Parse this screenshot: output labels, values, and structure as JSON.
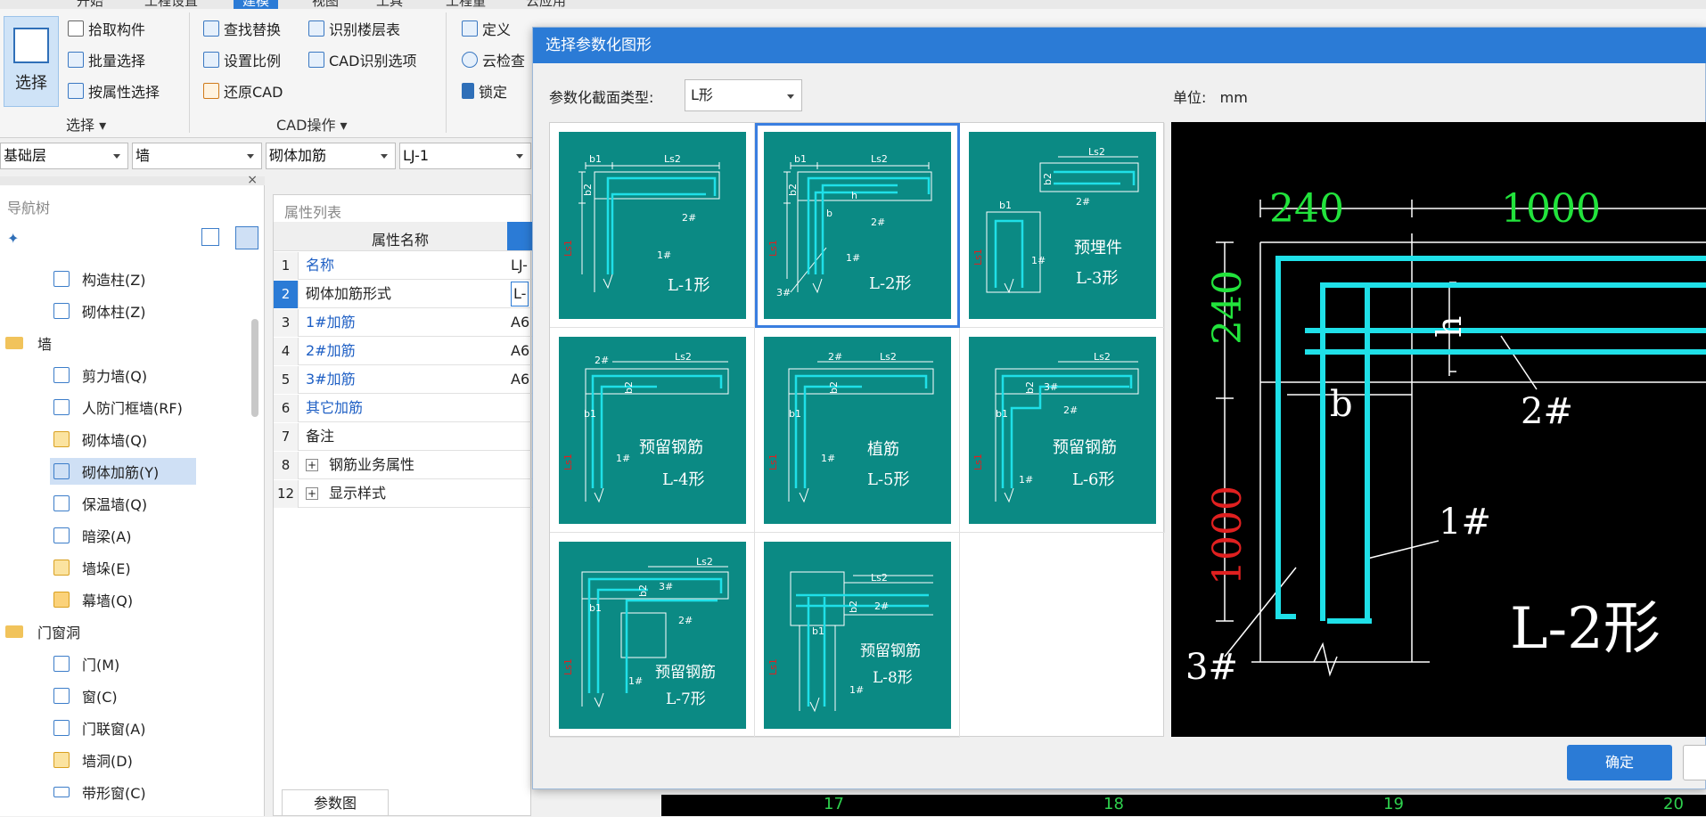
{
  "ribbon": {
    "tabs": [
      "开始",
      "工程设置",
      "建模",
      "视图",
      "工具",
      "工程量",
      "云应用"
    ],
    "active_tab": "建模",
    "select_big": "选择",
    "group_select": {
      "items": [
        "拾取构件",
        "批量选择",
        "按属性选择"
      ],
      "title": "选择"
    },
    "group_cad": {
      "col1": [
        "查找替换",
        "设置比例",
        "还原CAD"
      ],
      "col2": [
        "识别楼层表",
        "CAD识别选项"
      ],
      "title": "CAD操作"
    },
    "group_misc": [
      "定义",
      "云检查",
      "锁定"
    ]
  },
  "toolbar": {
    "floor": "基础层",
    "category": "墙",
    "type": "砌体加筋",
    "instance": "LJ-1"
  },
  "nav": {
    "title": "导航树",
    "items": [
      {
        "label": "构造柱(Z)"
      },
      {
        "label": "砌体柱(Z)"
      },
      {
        "label": "墙",
        "group": true
      },
      {
        "label": "剪力墙(Q)"
      },
      {
        "label": "人防门框墙(RF)"
      },
      {
        "label": "砌体墙(Q)"
      },
      {
        "label": "砌体加筋(Y)",
        "selected": true
      },
      {
        "label": "保温墙(Q)"
      },
      {
        "label": "暗梁(A)"
      },
      {
        "label": "墙垛(E)"
      },
      {
        "label": "幕墙(Q)"
      },
      {
        "label": "门窗洞",
        "group": true
      },
      {
        "label": "门(M)"
      },
      {
        "label": "窗(C)"
      },
      {
        "label": "门联窗(A)"
      },
      {
        "label": "墙洞(D)"
      },
      {
        "label": "带形窗(C)"
      }
    ]
  },
  "props": {
    "title": "属性列表",
    "header": "属性名称",
    "rows": [
      {
        "n": "1",
        "k": "名称",
        "v": "LJ-",
        "blue": true
      },
      {
        "n": "2",
        "k": "砌体加筋形式",
        "v": "L-",
        "blue": false
      },
      {
        "n": "3",
        "k": "1#加筋",
        "v": "A6",
        "blue": true
      },
      {
        "n": "4",
        "k": "2#加筋",
        "v": "A6",
        "blue": true
      },
      {
        "n": "5",
        "k": "3#加筋",
        "v": "A6",
        "blue": true
      },
      {
        "n": "6",
        "k": "其它加筋",
        "v": "",
        "blue": true
      },
      {
        "n": "7",
        "k": "备注",
        "v": "",
        "blue": false
      },
      {
        "n": "8",
        "k": "钢筋业务属性",
        "v": "",
        "blue": false,
        "expand": true
      },
      {
        "n": "12",
        "k": "显示样式",
        "v": "",
        "blue": false,
        "expand": true
      }
    ],
    "bottom_tab": "参数图"
  },
  "cad_bottom": {
    "axes": [
      "17",
      "18",
      "19",
      "20"
    ]
  },
  "dialog": {
    "title": "选择参数化图形",
    "type_label": "参数化截面类型:",
    "type_value": "L形",
    "unit_label": "单位:",
    "unit_value": "mm",
    "ok": "确定",
    "shapes": [
      {
        "name": "L-1形",
        "extra": ""
      },
      {
        "name": "L-2形",
        "extra": "",
        "selected": true
      },
      {
        "name": "L-3形",
        "extra": "预埋件"
      },
      {
        "name": "L-4形",
        "extra": "预留钢筋"
      },
      {
        "name": "L-5形",
        "extra": "植筋"
      },
      {
        "name": "L-6形",
        "extra": "预留钢筋"
      },
      {
        "name": "L-7形",
        "extra": "预留钢筋"
      },
      {
        "name": "L-8形",
        "extra": "预留钢筋"
      }
    ],
    "dim_labels": {
      "b1": "b1",
      "b2": "b2",
      "ls2": "Ls2",
      "ls1": "Ls1",
      "r1": "1#",
      "r2": "2#",
      "r3": "3#",
      "b": "b",
      "h": "h"
    },
    "preview": {
      "dim_b1": "240",
      "dim_ls2": "1000",
      "dim_b2": "240",
      "dim_ls1": "1000",
      "label_h": "h",
      "label_b": "b",
      "label_2": "2#",
      "label_1": "1#",
      "label_3": "3#",
      "shape_name": "L-2形"
    }
  },
  "colors": {
    "accent": "#2b7bd6",
    "thumb_bg": "#0b8a84",
    "rebar": "#1fe0e8",
    "dim_green": "#22e33c",
    "dim_red": "#e02020"
  }
}
